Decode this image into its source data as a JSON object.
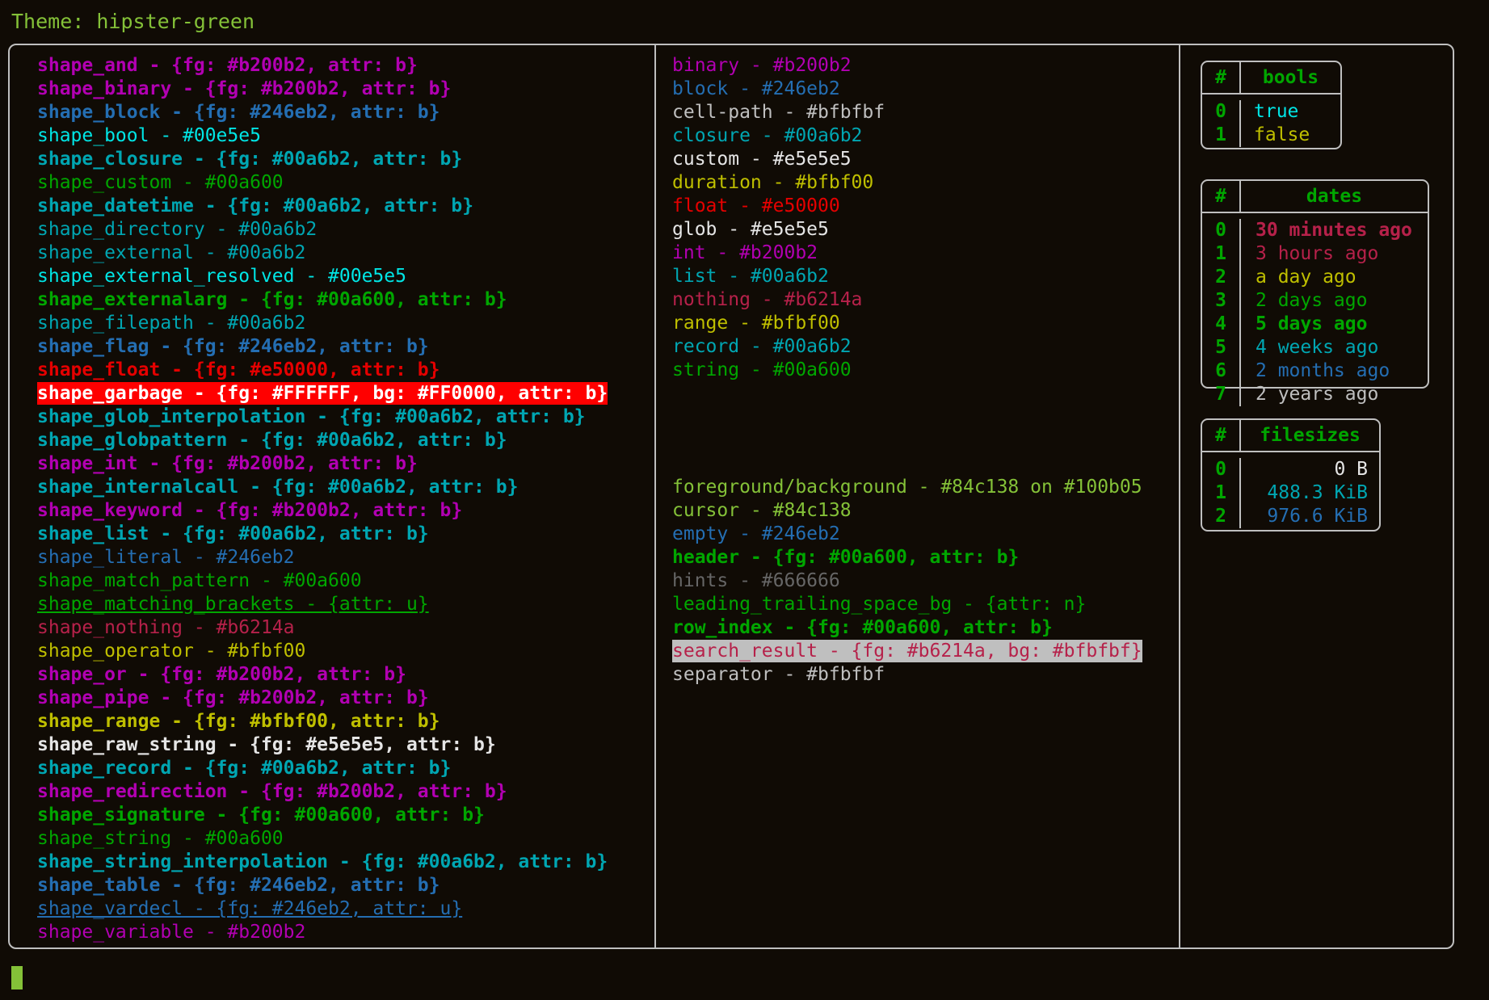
{
  "theme": {
    "label": "Theme: hipster-green",
    "name": "hipster-green",
    "foreground": "#84c138",
    "background": "#100b05",
    "border_color": "#bfbfbf",
    "cursor_color": "#84c138"
  },
  "shapes": [
    {
      "text": "shape_and - {fg: #b200b2, attr: b}",
      "fg": "#b200b2",
      "bold": true,
      "underline": false
    },
    {
      "text": "shape_binary - {fg: #b200b2, attr: b}",
      "fg": "#b200b2",
      "bold": true,
      "underline": false
    },
    {
      "text": "shape_block - {fg: #246eb2, attr: b}",
      "fg": "#246eb2",
      "bold": true,
      "underline": false
    },
    {
      "text": "shape_bool - #00e5e5",
      "fg": "#00e5e5",
      "bold": false,
      "underline": false
    },
    {
      "text": "shape_closure - {fg: #00a6b2, attr: b}",
      "fg": "#00a6b2",
      "bold": true,
      "underline": false
    },
    {
      "text": "shape_custom - #00a600",
      "fg": "#00a600",
      "bold": false,
      "underline": false
    },
    {
      "text": "shape_datetime - {fg: #00a6b2, attr: b}",
      "fg": "#00a6b2",
      "bold": true,
      "underline": false
    },
    {
      "text": "shape_directory - #00a6b2",
      "fg": "#00a6b2",
      "bold": false,
      "underline": false
    },
    {
      "text": "shape_external - #00a6b2",
      "fg": "#00a6b2",
      "bold": false,
      "underline": false
    },
    {
      "text": "shape_external_resolved - #00e5e5",
      "fg": "#00e5e5",
      "bold": false,
      "underline": false
    },
    {
      "text": "shape_externalarg - {fg: #00a600, attr: b}",
      "fg": "#00a600",
      "bold": true,
      "underline": false
    },
    {
      "text": "shape_filepath - #00a6b2",
      "fg": "#00a6b2",
      "bold": false,
      "underline": false
    },
    {
      "text": "shape_flag - {fg: #246eb2, attr: b}",
      "fg": "#246eb2",
      "bold": true,
      "underline": false
    },
    {
      "text": "shape_float - {fg: #e50000, attr: b}",
      "fg": "#e50000",
      "bold": true,
      "underline": false
    },
    {
      "text": "shape_garbage - {fg: #FFFFFF, bg: #FF0000, attr: b}",
      "fg": "#FFFFFF",
      "bg": "#FF0000",
      "bold": true,
      "underline": false
    },
    {
      "text": "shape_glob_interpolation - {fg: #00a6b2, attr: b}",
      "fg": "#00a6b2",
      "bold": true,
      "underline": false
    },
    {
      "text": "shape_globpattern - {fg: #00a6b2, attr: b}",
      "fg": "#00a6b2",
      "bold": true,
      "underline": false
    },
    {
      "text": "shape_int - {fg: #b200b2, attr: b}",
      "fg": "#b200b2",
      "bold": true,
      "underline": false
    },
    {
      "text": "shape_internalcall - {fg: #00a6b2, attr: b}",
      "fg": "#00a6b2",
      "bold": true,
      "underline": false
    },
    {
      "text": "shape_keyword - {fg: #b200b2, attr: b}",
      "fg": "#b200b2",
      "bold": true,
      "underline": false
    },
    {
      "text": "shape_list - {fg: #00a6b2, attr: b}",
      "fg": "#00a6b2",
      "bold": true,
      "underline": false
    },
    {
      "text": "shape_literal - #246eb2",
      "fg": "#246eb2",
      "bold": false,
      "underline": false
    },
    {
      "text": "shape_match_pattern - #00a600",
      "fg": "#00a600",
      "bold": false,
      "underline": false
    },
    {
      "text": "shape_matching_brackets - {attr: u}",
      "fg": "#00a600",
      "bold": false,
      "underline": true
    },
    {
      "text": "shape_nothing - #b6214a",
      "fg": "#b6214a",
      "bold": false,
      "underline": false
    },
    {
      "text": "shape_operator - #bfbf00",
      "fg": "#bfbf00",
      "bold": false,
      "underline": false
    },
    {
      "text": "shape_or - {fg: #b200b2, attr: b}",
      "fg": "#b200b2",
      "bold": true,
      "underline": false
    },
    {
      "text": "shape_pipe - {fg: #b200b2, attr: b}",
      "fg": "#b200b2",
      "bold": true,
      "underline": false
    },
    {
      "text": "shape_range - {fg: #bfbf00, attr: b}",
      "fg": "#bfbf00",
      "bold": true,
      "underline": false
    },
    {
      "text": "shape_raw_string - {fg: #e5e5e5, attr: b}",
      "fg": "#e5e5e5",
      "bold": true,
      "underline": false
    },
    {
      "text": "shape_record - {fg: #00a6b2, attr: b}",
      "fg": "#00a6b2",
      "bold": true,
      "underline": false
    },
    {
      "text": "shape_redirection - {fg: #b200b2, attr: b}",
      "fg": "#b200b2",
      "bold": true,
      "underline": false
    },
    {
      "text": "shape_signature - {fg: #00a600, attr: b}",
      "fg": "#00a600",
      "bold": true,
      "underline": false
    },
    {
      "text": "shape_string - #00a600",
      "fg": "#00a600",
      "bold": false,
      "underline": false
    },
    {
      "text": "shape_string_interpolation - {fg: #00a6b2, attr: b}",
      "fg": "#00a6b2",
      "bold": true,
      "underline": false
    },
    {
      "text": "shape_table - {fg: #246eb2, attr: b}",
      "fg": "#246eb2",
      "bold": true,
      "underline": false
    },
    {
      "text": "shape_vardecl - {fg: #246eb2, attr: u}",
      "fg": "#246eb2",
      "bold": false,
      "underline": true
    },
    {
      "text": "shape_variable - #b200b2",
      "fg": "#b200b2",
      "bold": false,
      "underline": false
    }
  ],
  "types": [
    {
      "text": "binary - #b200b2",
      "fg": "#b200b2",
      "bold": false,
      "underline": false
    },
    {
      "text": "block - #246eb2",
      "fg": "#246eb2",
      "bold": false,
      "underline": false
    },
    {
      "text": "cell-path - #bfbfbf",
      "fg": "#bfbfbf",
      "bold": false,
      "underline": false
    },
    {
      "text": "closure - #00a6b2",
      "fg": "#00a6b2",
      "bold": false,
      "underline": false
    },
    {
      "text": "custom - #e5e5e5",
      "fg": "#e5e5e5",
      "bold": false,
      "underline": false
    },
    {
      "text": "duration - #bfbf00",
      "fg": "#bfbf00",
      "bold": false,
      "underline": false
    },
    {
      "text": "float - #e50000",
      "fg": "#e50000",
      "bold": false,
      "underline": false
    },
    {
      "text": "glob - #e5e5e5",
      "fg": "#e5e5e5",
      "bold": false,
      "underline": false
    },
    {
      "text": "int - #b200b2",
      "fg": "#b200b2",
      "bold": false,
      "underline": false
    },
    {
      "text": "list - #00a6b2",
      "fg": "#00a6b2",
      "bold": false,
      "underline": false
    },
    {
      "text": "nothing - #b6214a",
      "fg": "#b6214a",
      "bold": false,
      "underline": false
    },
    {
      "text": "range - #bfbf00",
      "fg": "#bfbf00",
      "bold": false,
      "underline": false
    },
    {
      "text": "record - #00a6b2",
      "fg": "#00a6b2",
      "bold": false,
      "underline": false
    },
    {
      "text": "string - #00a600",
      "fg": "#00a600",
      "bold": false,
      "underline": false
    },
    {
      "text": "",
      "fg": "#84c138",
      "bold": false,
      "underline": false
    },
    {
      "text": "",
      "fg": "#84c138",
      "bold": false,
      "underline": false
    },
    {
      "text": "",
      "fg": "#84c138",
      "bold": false,
      "underline": false
    },
    {
      "text": "",
      "fg": "#84c138",
      "bold": false,
      "underline": false
    },
    {
      "text": "foreground/background - #84c138 on #100b05",
      "fg": "#84c138",
      "bold": false,
      "underline": false
    },
    {
      "text": "cursor - #84c138",
      "fg": "#84c138",
      "bold": false,
      "underline": false
    },
    {
      "text": "empty - #246eb2",
      "fg": "#246eb2",
      "bold": false,
      "underline": false
    },
    {
      "text": "header - {fg: #00a600, attr: b}",
      "fg": "#00a600",
      "bold": true,
      "underline": false
    },
    {
      "text": "hints - #666666",
      "fg": "#666666",
      "bold": false,
      "underline": false
    },
    {
      "text": "leading_trailing_space_bg - {attr: n}",
      "fg": "#00a600",
      "bold": false,
      "underline": false
    },
    {
      "text": "row_index - {fg: #00a600, attr: b}",
      "fg": "#00a600",
      "bold": true,
      "underline": false
    },
    {
      "text": "search_result - {fg: #b6214a, bg: #bfbfbf}",
      "fg": "#b6214a",
      "bg": "#bfbfbf",
      "bold": false,
      "underline": false
    },
    {
      "text": "separator - #bfbfbf",
      "fg": "#bfbfbf",
      "bold": false,
      "underline": false
    }
  ],
  "tables": [
    {
      "id": "bools",
      "header": {
        "index": "#",
        "value": "bools"
      },
      "rows": [
        {
          "index": "0",
          "value": "true",
          "fg": "#00e5e5",
          "bold": false
        },
        {
          "index": "1",
          "value": "false",
          "fg": "#bfbf00",
          "bold": false
        }
      ]
    },
    {
      "id": "dates",
      "header": {
        "index": "#",
        "value": "dates"
      },
      "rows": [
        {
          "index": "0",
          "value": "30 minutes ago",
          "fg": "#b6214a",
          "bold": true
        },
        {
          "index": "1",
          "value": "3 hours ago",
          "fg": "#b6214a",
          "bold": false
        },
        {
          "index": "2",
          "value": "a day ago",
          "fg": "#bfbf00",
          "bold": false
        },
        {
          "index": "3",
          "value": "2 days ago",
          "fg": "#00a600",
          "bold": false
        },
        {
          "index": "4",
          "value": "5 days ago",
          "fg": "#00a600",
          "bold": true
        },
        {
          "index": "5",
          "value": "4 weeks ago",
          "fg": "#00a6b2",
          "bold": false
        },
        {
          "index": "6",
          "value": "2 months ago",
          "fg": "#246eb2",
          "bold": false
        },
        {
          "index": "7",
          "value": "2 years ago",
          "fg": "#bfbfbf",
          "bold": false
        }
      ]
    },
    {
      "id": "filesizes",
      "header": {
        "index": "#",
        "value": "filesizes"
      },
      "rows": [
        {
          "index": "0",
          "value": "0 B",
          "fg": "#e5e5e5",
          "bold": false
        },
        {
          "index": "1",
          "value": "488.3 KiB",
          "fg": "#00a6b2",
          "bold": false
        },
        {
          "index": "2",
          "value": "976.6 KiB",
          "fg": "#246eb2",
          "bold": false
        }
      ]
    }
  ]
}
